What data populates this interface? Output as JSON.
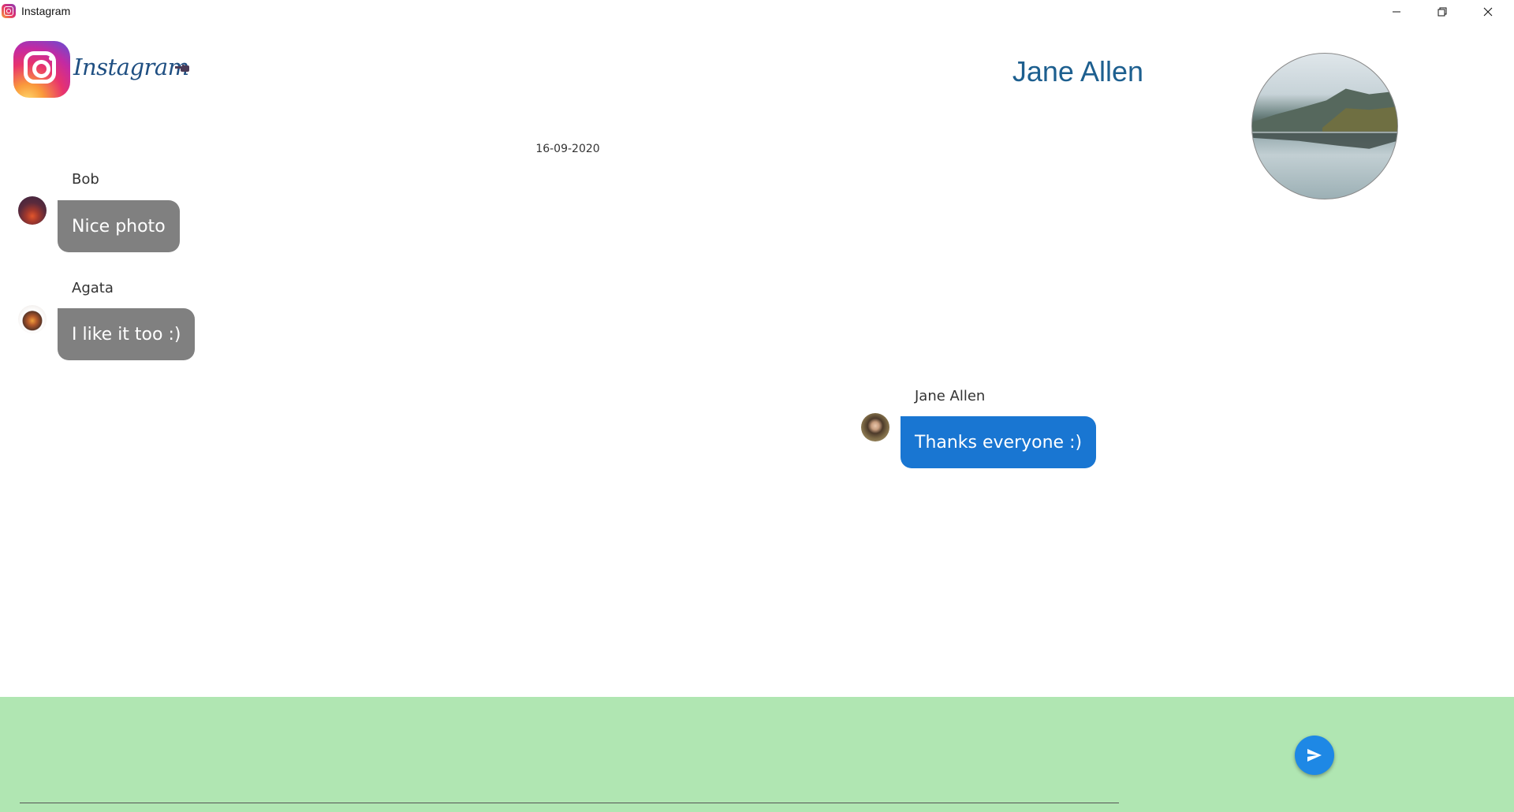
{
  "window": {
    "title": "Instagram",
    "controls": {
      "minimize_icon": "minimize-icon",
      "maximize_icon": "restore-icon",
      "close_icon": "close-icon"
    }
  },
  "header": {
    "brand": "Instagram",
    "logo_icon": "instagram-logo-icon",
    "pointer_icon": "pointing-hand-icon",
    "contact_name": "Jane Allen",
    "contact_photo_icon": "lake-mountain-photo"
  },
  "chat": {
    "date": "16-09-2020",
    "messages": [
      {
        "sender": "Bob",
        "text": "Nice photo",
        "side": "left",
        "color": "#808080",
        "avatar": "sunset-avatar"
      },
      {
        "sender": "Agata",
        "text": "I like it too :)",
        "side": "left",
        "color": "#808080",
        "avatar": "campfire-avatar"
      },
      {
        "sender": "Jane Allen",
        "text": "Thanks everyone :)",
        "side": "right",
        "color": "#1976d2",
        "avatar": "woman-portrait-avatar"
      }
    ]
  },
  "composer": {
    "value": "",
    "placeholder": "",
    "background": "#b0e6b2",
    "send_icon": "send-icon",
    "send_color": "#1e88e5"
  }
}
